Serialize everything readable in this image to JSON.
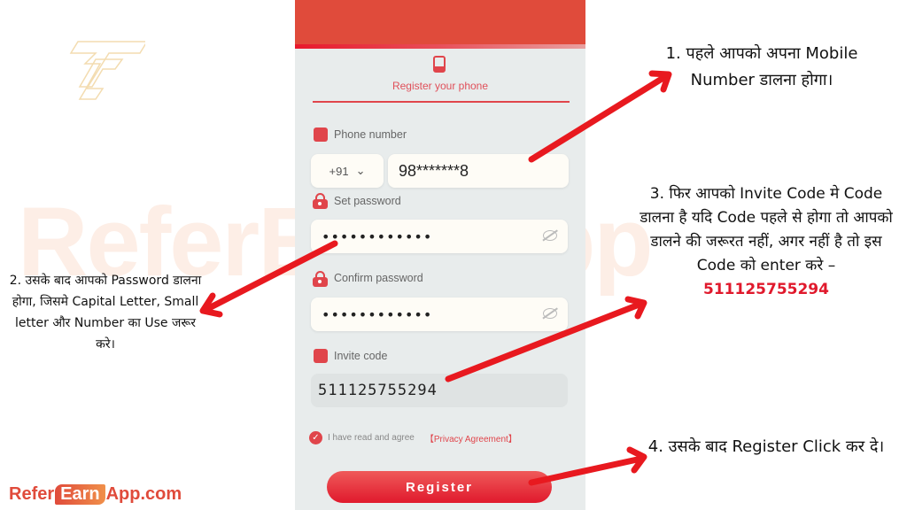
{
  "background_watermark": "ReferEarnApp",
  "logo": {
    "icon": "tc-logo-icon"
  },
  "phone_form": {
    "header_icon": "mobile-phone-icon",
    "title": "Register your phone",
    "phone_label": "Phone number",
    "country_code": "+91",
    "country_chevron": "⌄",
    "phone_value": "98*******8",
    "set_password_label": "Set password",
    "set_password_value": "••••••••••••",
    "confirm_password_label": "Confirm password",
    "confirm_password_value": "••••••••••••",
    "invite_code_label": "Invite code",
    "invite_code_value": "511125755294",
    "agree_text": "I have read and agree",
    "privacy_link": "【Privacy Agreement】",
    "checkbox_checked": true,
    "register_button": "Register"
  },
  "notes": {
    "step1": "1.  पहले आपको अपना Mobile Number डालना होगा।",
    "step2": "2. उसके बाद आपको Password डालना होगा, जिसमे Capital Letter, Small letter और Number का Use जरूर करे।",
    "step3_prefix": "3. फिर आपको Invite Code मे Code डालना है यदि Code पहले से होगा तो आपको डालने की जरूरत नहीं, अगर नहीं है तो इस Code को enter करे – ",
    "step3_code": "511125755294",
    "step4": "4. उसके बाद Register Click कर दे।"
  },
  "brand": {
    "part1": "Refer",
    "part2": "Earn",
    "part3": "App.com"
  },
  "colors": {
    "accent": "#e0192c",
    "header": "#e04b3b",
    "arrow": "#e8191f"
  }
}
